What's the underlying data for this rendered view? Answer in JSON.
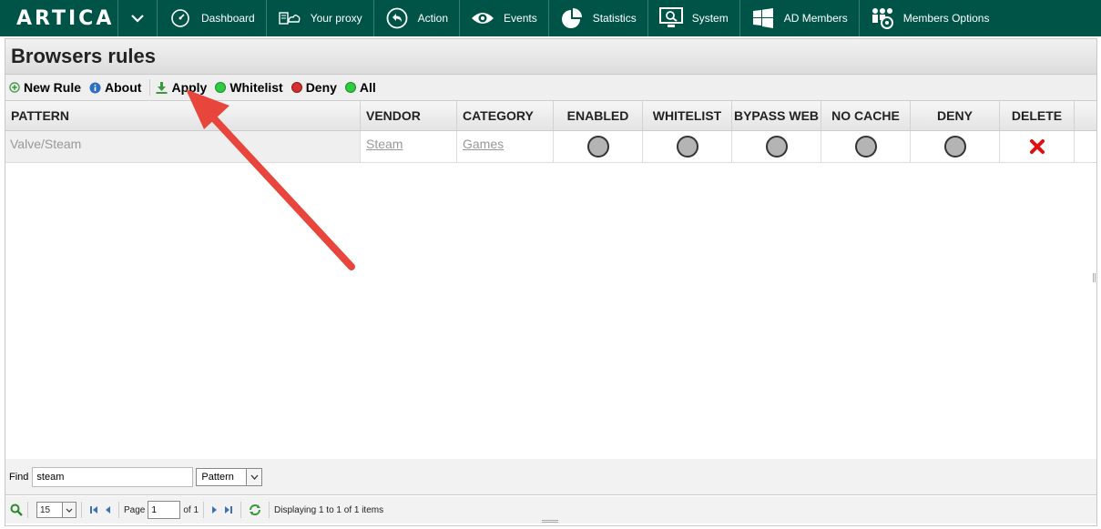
{
  "app": {
    "logo": "ARTICA"
  },
  "nav": {
    "items": [
      {
        "label": "Dashboard",
        "icon": "dashboard-gauge-icon"
      },
      {
        "label": "Your proxy",
        "icon": "proxy-cloud-icon"
      },
      {
        "label": "Action",
        "icon": "action-back-arrow-icon"
      },
      {
        "label": "Events",
        "icon": "eye-icon"
      },
      {
        "label": "Statistics",
        "icon": "pie-chart-icon"
      },
      {
        "label": "System",
        "icon": "monitor-icon"
      },
      {
        "label": "AD Members",
        "icon": "windows-logo-icon"
      },
      {
        "label": "Members Options",
        "icon": "members-gear-icon"
      }
    ]
  },
  "page": {
    "title": "Browsers rules"
  },
  "toolbar": {
    "new_rule": "New Rule",
    "about": "About",
    "apply": "Apply",
    "whitelist": "Whitelist",
    "deny": "Deny",
    "all": "All"
  },
  "table": {
    "columns": [
      "PATTERN",
      "VENDOR",
      "CATEGORY",
      "ENABLED",
      "WHITELIST",
      "BYPASS WEB",
      "NO CACHE",
      "DENY",
      "DELETE"
    ],
    "rows": [
      {
        "pattern": "Valve/Steam",
        "vendor": "Steam",
        "category": "Games"
      }
    ]
  },
  "find": {
    "label": "Find",
    "value": "steam",
    "field": "Pattern"
  },
  "pager": {
    "per_page": "15",
    "page_label": "Page",
    "page_value": "1",
    "of_label": "of 1",
    "status": "Displaying 1 to 1 of 1 items"
  },
  "colors": {
    "nav_bg": "#005447",
    "status_green": "#2ecc40",
    "status_red": "#d32f2f",
    "delete_red": "#e01010",
    "annotation_arrow": "#e8453c"
  }
}
